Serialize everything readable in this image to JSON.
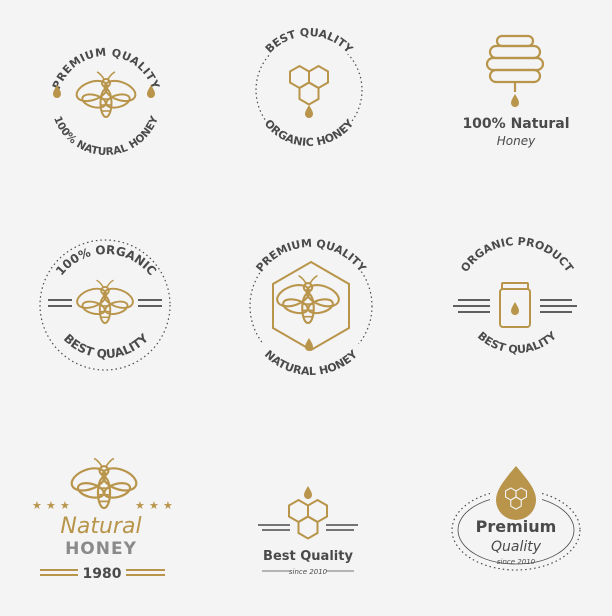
{
  "colors": {
    "gold": "#b8954b",
    "dark": "#4a4a4a",
    "background": "#f4f4f4"
  },
  "badges": [
    {
      "top_text": "PREMIUM QUALITY",
      "bottom_text": "100% NATURAL HONEY",
      "icon": "bee-icon"
    },
    {
      "top_text": "BEST QUALITY",
      "bottom_text": "ORGANIC HONEY",
      "icon": "honeycomb-icon"
    },
    {
      "line1": "100% Natural",
      "line2": "Honey",
      "icon": "beehive-icon"
    },
    {
      "top_text": "100% ORGANIC",
      "bottom_text": "BEST QUALITY",
      "icon": "bee-icon"
    },
    {
      "top_text": "PREMIUM QUALITY",
      "bottom_text": "NATURAL HONEY",
      "icon": "bee-hexagon-icon"
    },
    {
      "top_text": "ORGANIC PRODUCT",
      "bottom_text": "BEST QUALITY",
      "icon": "honey-jar-icon"
    },
    {
      "line1": "Natural",
      "line2": "HONEY",
      "year": "1980",
      "icon": "bee-icon"
    },
    {
      "line1": "Best Quality",
      "since": "since 2010",
      "icon": "honeycomb-icon"
    },
    {
      "line1": "Premium",
      "line2": "Quality",
      "since": "since 2010",
      "icon": "honey-drop-icon"
    }
  ]
}
